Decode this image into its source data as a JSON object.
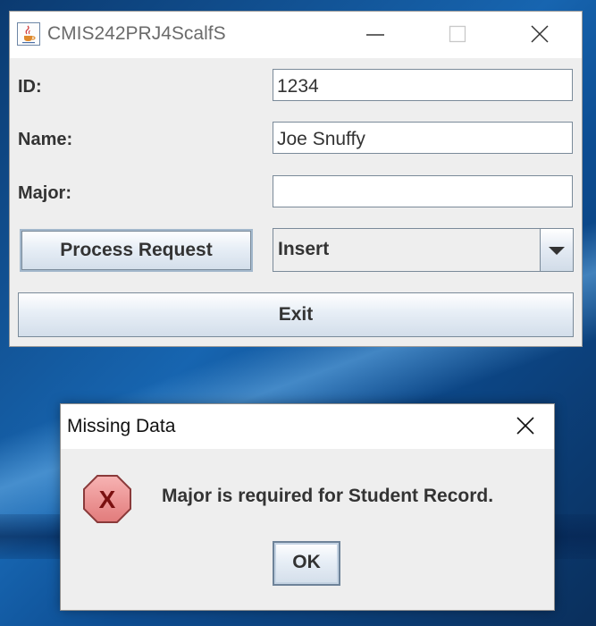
{
  "main_window": {
    "title": "CMIS242PRJ4ScalfS",
    "fields": {
      "id_label": "ID:",
      "id_value": "1234",
      "name_label": "Name:",
      "name_value": "Joe Snuffy",
      "major_label": "Major:",
      "major_value": ""
    },
    "process_button_label": "Process Request",
    "action_select": {
      "selected": "Insert"
    },
    "exit_button_label": "Exit"
  },
  "dialog": {
    "title": "Missing Data",
    "message": "Major is required for Student Record.",
    "ok_label": "OK",
    "icon": "error-icon"
  },
  "colors": {
    "button_border": "#7a8a99",
    "error_red": "#d9534f",
    "desktop_blue": "#1765b0"
  }
}
